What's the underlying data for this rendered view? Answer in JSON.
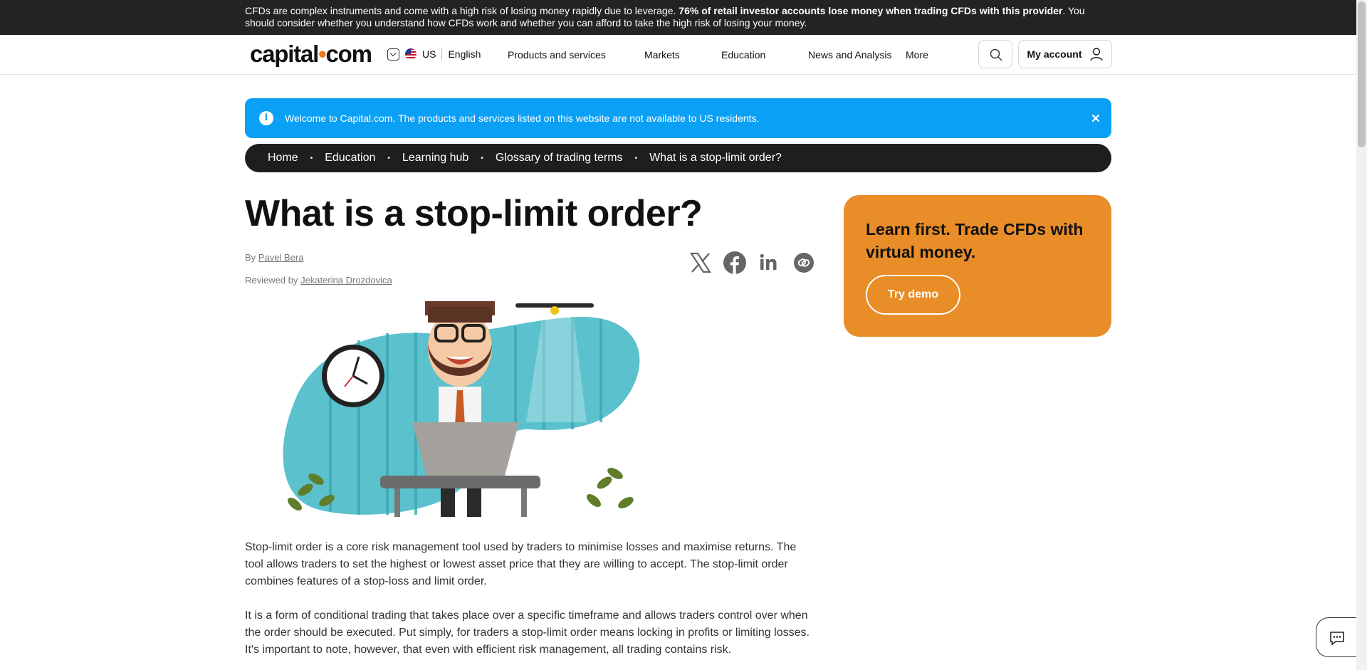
{
  "risk_warning": {
    "text_before": "CFDs are complex instruments and come with a high risk of losing money rapidly due to leverage. ",
    "text_bold": "76% of retail investor accounts lose money when trading CFDs with this provider",
    "text_after": ". You should consider whether you understand how CFDs work and whether you can afford to take the high risk of losing your money."
  },
  "header": {
    "logo_left": "capital",
    "logo_dot": "•",
    "logo_right": "com",
    "region": "US",
    "language": "English",
    "nav": [
      "Products and services",
      "Markets",
      "Education",
      "News and Analysis",
      "More"
    ],
    "account_label": "My account"
  },
  "info_banner": {
    "text": "Welcome to Capital.com. The products and services listed on this website are not available to US residents."
  },
  "breadcrumb": [
    "Home",
    "Education",
    "Learning hub",
    "Glossary of trading terms",
    "What is a stop-limit order?"
  ],
  "article": {
    "title": "What is a stop-limit order?",
    "by_label": "By",
    "author": "Pavel Bera",
    "reviewed_label": "Reviewed by",
    "reviewer": "Jekaterina Drozdovica",
    "paragraphs": [
      "Stop-limit order is a core risk management tool used by traders to minimise losses and maximise returns. The tool allows traders to set the highest or lowest asset price that they are willing to accept. The stop-limit order combines features of a stop-loss and limit order.",
      "It is a form of conditional trading that takes place over a specific timeframe and allows traders control over when the order should be executed. Put simply, for traders a stop-limit order means locking in profits or limiting losses. It's important to note, however, that even with efficient risk management, all trading contains risk."
    ]
  },
  "cta": {
    "title": "Learn first. Trade CFDs with virtual money.",
    "button": "Try demo"
  },
  "colors": {
    "risk_bar": "#232323",
    "info_banner": "#0aa0f5",
    "breadcrumb_bg": "#1e1e1e",
    "cta_bg": "#e98d28",
    "logo_accent": "#ee7b1f"
  }
}
